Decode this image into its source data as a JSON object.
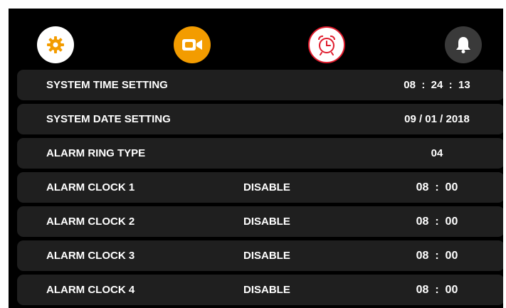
{
  "colors": {
    "background": "#000000",
    "row": "#1f1f1f",
    "text": "#ffffff",
    "video_tab": "#f39c00",
    "settings_gear": "#f39c00",
    "alarm_accent": "#e01b2c",
    "bell_tab": "#3a3a3a"
  },
  "tabs": [
    {
      "icon": "gear-icon"
    },
    {
      "icon": "video-camera-icon"
    },
    {
      "icon": "alarm-clock-icon"
    },
    {
      "icon": "bell-icon"
    }
  ],
  "rows": [
    {
      "label": "SYSTEM TIME SETTING",
      "status": "",
      "value": "08  :  24  :  13"
    },
    {
      "label": "SYSTEM DATE SETTING",
      "status": "",
      "value": "09 / 01 / 2018"
    },
    {
      "label": "ALARM RING TYPE",
      "status": "",
      "value": "04"
    },
    {
      "label": "ALARM CLOCK 1",
      "status": "DISABLE",
      "value": "08  :  00"
    },
    {
      "label": "ALARM CLOCK 2",
      "status": "DISABLE",
      "value": "08  :  00"
    },
    {
      "label": "ALARM CLOCK 3",
      "status": "DISABLE",
      "value": "08  :  00"
    },
    {
      "label": "ALARM CLOCK 4",
      "status": "DISABLE",
      "value": "08  :  00"
    }
  ]
}
